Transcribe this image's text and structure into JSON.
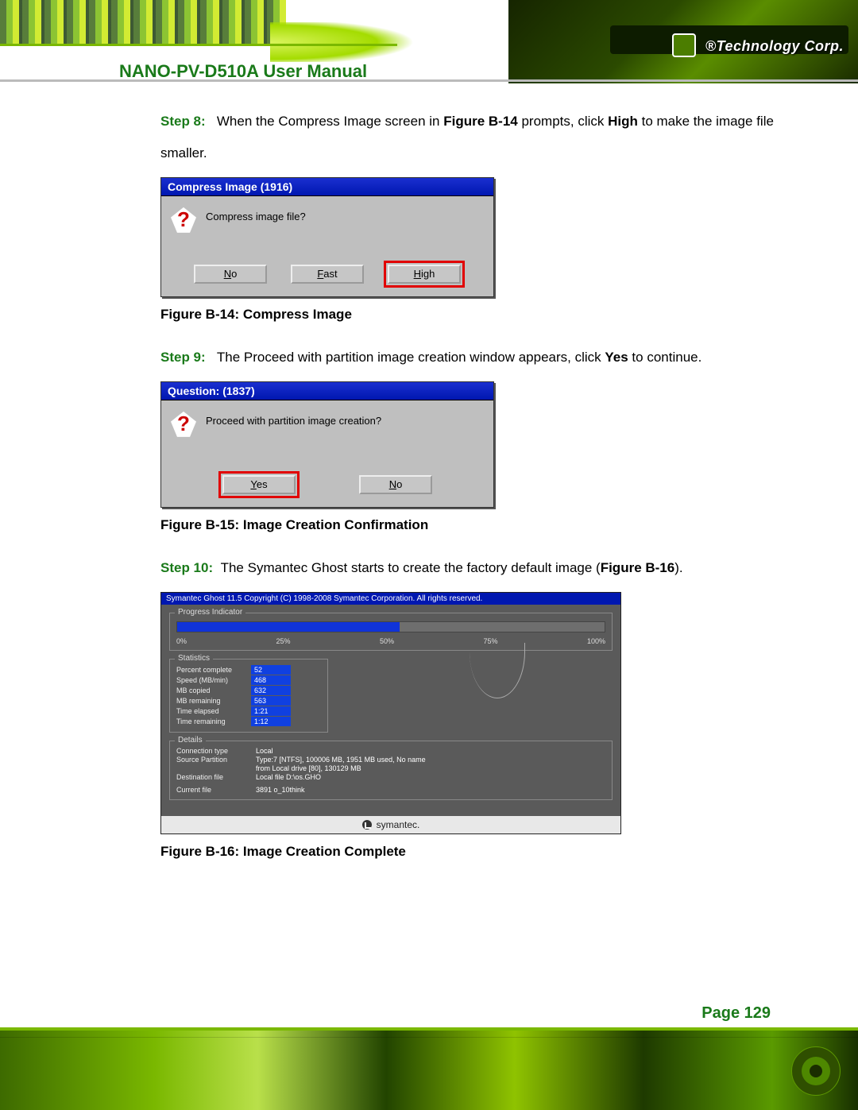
{
  "brand": "®Technology Corp.",
  "page_title": "NANO-PV-D510A User Manual",
  "step8": {
    "label": "Step 8:",
    "text_a": "When the Compress Image screen in ",
    "fig_ref": "Figure B-14",
    "text_b": " prompts, click ",
    "bold_word": "High",
    "text_c": " to make the image file smaller."
  },
  "dialog1": {
    "title": "Compress Image (1916)",
    "question": "Compress image file?",
    "btn_no": "No",
    "btn_fast": "Fast",
    "btn_high": "High"
  },
  "figcap1": "Figure B-14: Compress Image",
  "step9": {
    "label": "Step 9:",
    "text_a": "The Proceed with partition image creation window appears, click ",
    "bold_word": "Yes",
    "text_b": " to continue."
  },
  "dialog2": {
    "title": "Question: (1837)",
    "question": "Proceed with partition image creation?",
    "btn_yes": "Yes",
    "btn_no": "No"
  },
  "figcap2": "Figure B-15: Image Creation Confirmation",
  "step10": {
    "label": "Step 10:",
    "text_a": "The Symantec Ghost starts to create the factory default image (",
    "fig_ref": "Figure B-16",
    "text_b": ")."
  },
  "ghost": {
    "title": "Symantec Ghost 11.5   Copyright (C) 1998-2008 Symantec Corporation.  All rights reserved.",
    "progress_label": "Progress Indicator",
    "ticks": [
      "0%",
      "25%",
      "50%",
      "75%",
      "100%"
    ],
    "stats_label": "Statistics",
    "stats": [
      {
        "k": "Percent complete",
        "v": "52"
      },
      {
        "k": "Speed (MB/min)",
        "v": "468"
      },
      {
        "k": "MB copied",
        "v": "632"
      },
      {
        "k": "MB remaining",
        "v": "563"
      },
      {
        "k": "Time elapsed",
        "v": "1:21"
      },
      {
        "k": "Time remaining",
        "v": "1:12"
      }
    ],
    "details_label": "Details",
    "details": [
      {
        "k": "Connection type",
        "v": "Local"
      },
      {
        "k": "Source Partition",
        "v": "Type:7 [NTFS], 100006 MB, 1951 MB used, No name"
      },
      {
        "k": "",
        "v": "from Local drive [80], 130129 MB"
      },
      {
        "k": "Destination file",
        "v": "Local file D:\\os.GHO"
      },
      {
        "k": "Current file",
        "v": "3891 o_10think"
      }
    ],
    "symantec": "symantec."
  },
  "figcap3": "Figure B-16: Image Creation Complete",
  "page_number": "Page 129"
}
